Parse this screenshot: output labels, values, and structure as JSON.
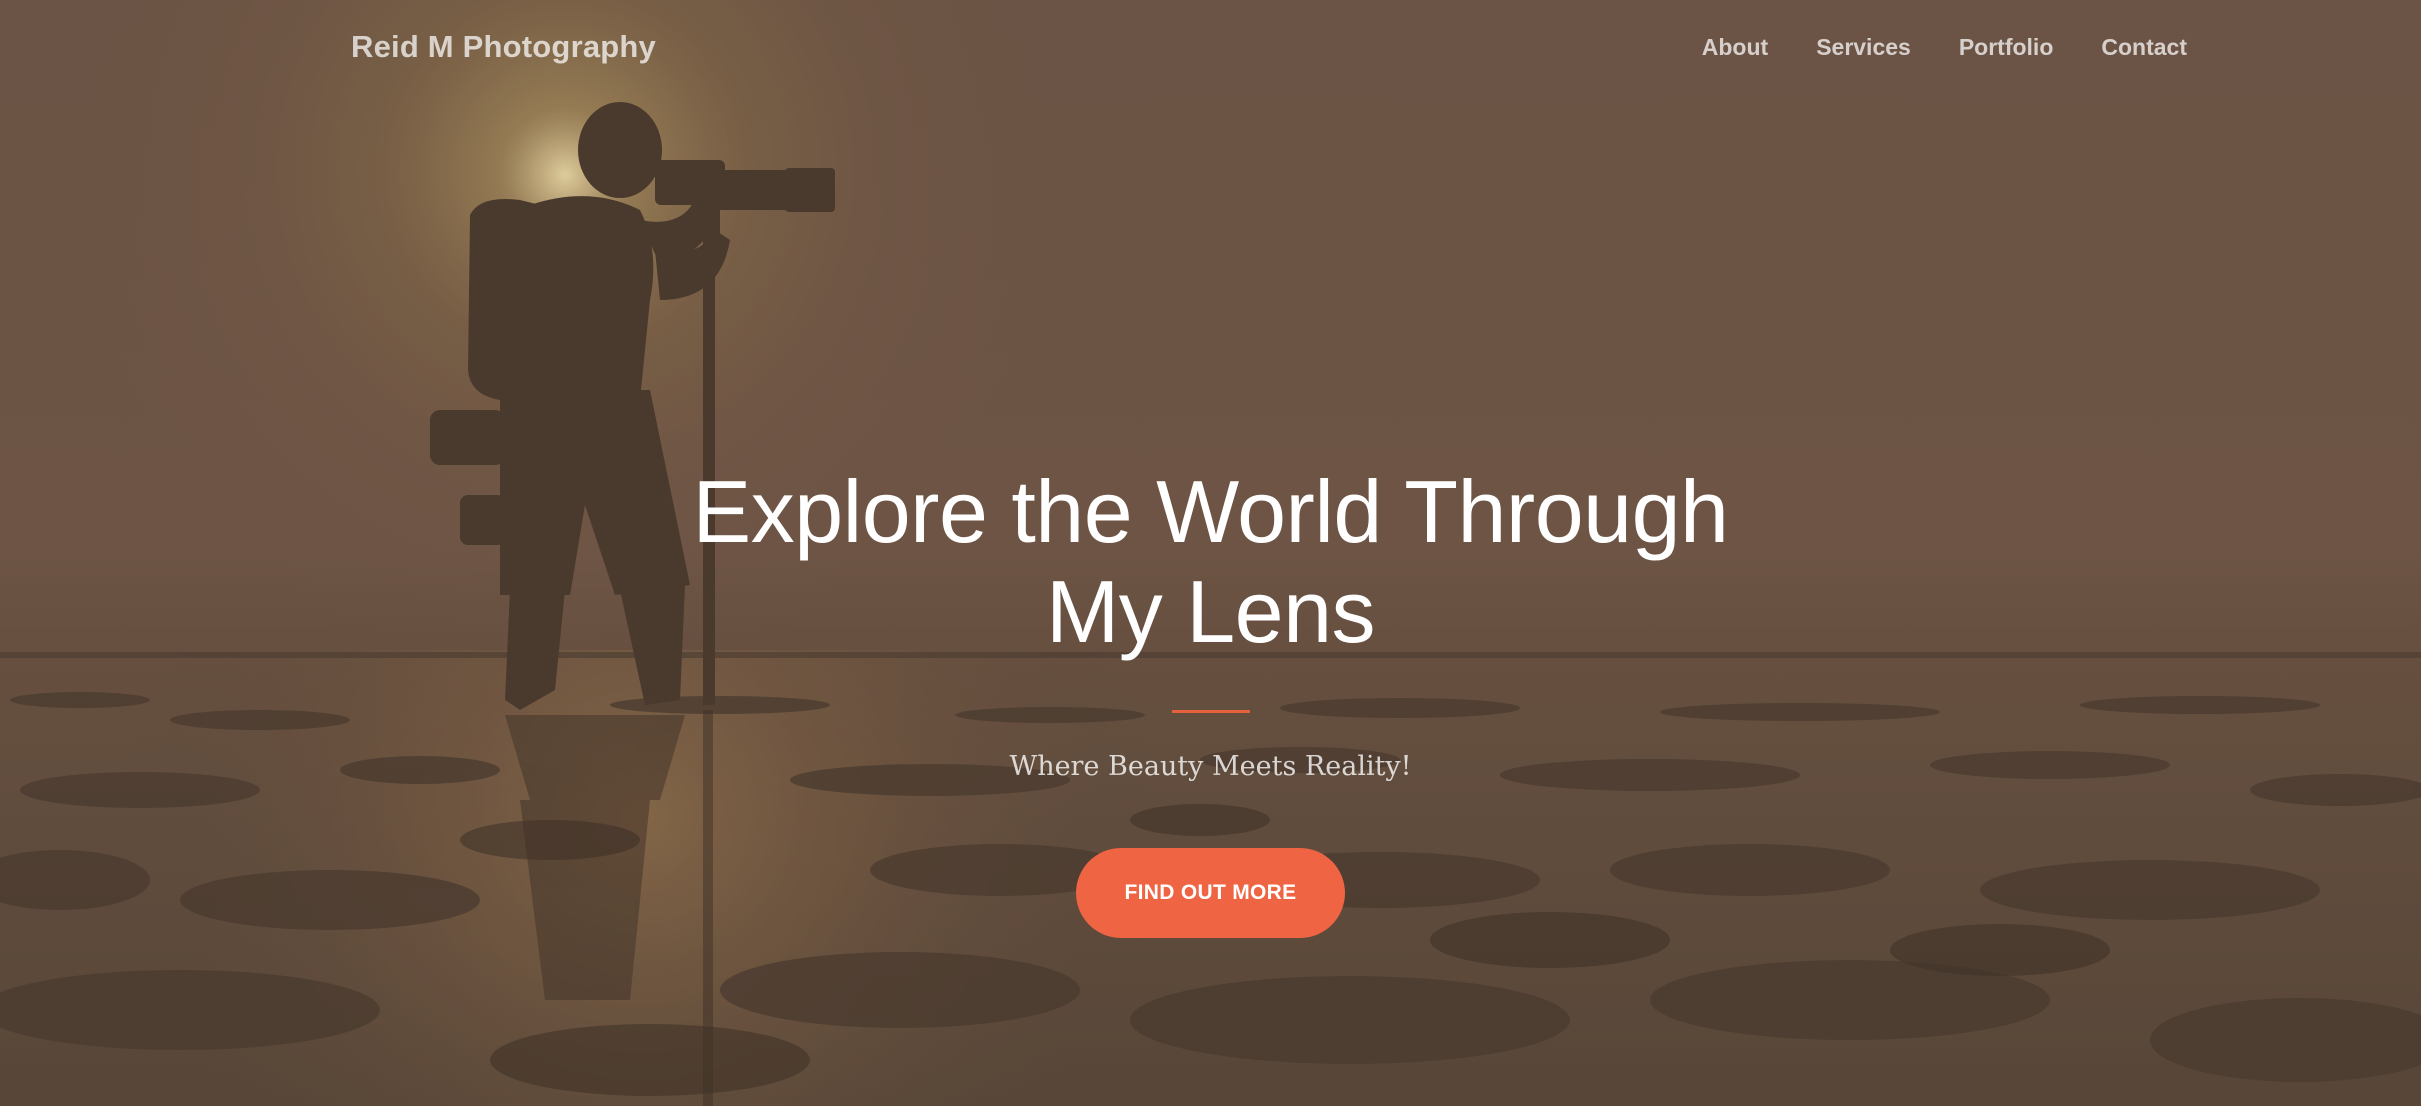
{
  "brand": {
    "name": "Reid M Photography"
  },
  "nav": {
    "items": [
      {
        "label": "About"
      },
      {
        "label": "Services"
      },
      {
        "label": "Portfolio"
      },
      {
        "label": "Contact"
      }
    ]
  },
  "hero": {
    "title": "Explore the World Through My Lens",
    "subtitle": "Where Beauty Meets Reality!",
    "cta_label": "FIND OUT MORE",
    "background_image": "silhouette of photographer with telephoto lens on tripod standing on wet tidal flats at sunset",
    "icon": "photo-icon"
  },
  "colors": {
    "accent": "#ef6442",
    "divider": "#e4613c",
    "overlay": "#6b5848",
    "text": "#ffffff"
  }
}
